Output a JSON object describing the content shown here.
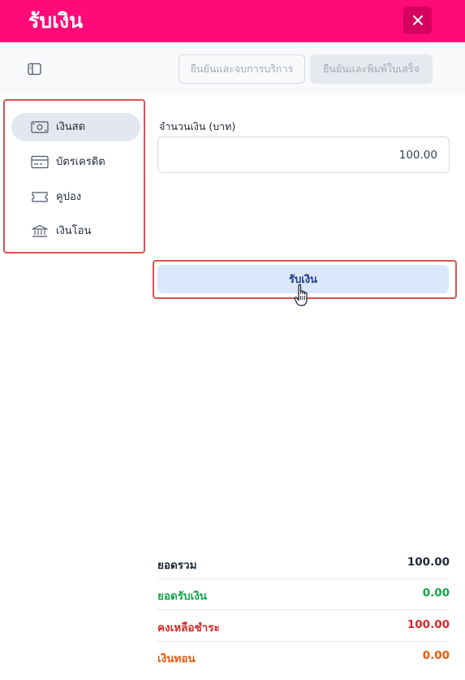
{
  "header": {
    "title": "รับเงิน",
    "close_icon": "close-icon",
    "colors": {
      "header_bg": "#ff0a78",
      "close_bg": "#d6005f"
    }
  },
  "toolbar": {
    "sidebar_toggle_icon": "sidebar-toggle-icon",
    "confirm_end_service_label": "ยืนยันและจบการบริการ",
    "confirm_print_receipt_label": "ยืนยันและพิมพ์ใบเสร็จ"
  },
  "payment_methods": {
    "items": [
      {
        "label": "เงินสด",
        "icon": "cash-icon",
        "active": true
      },
      {
        "label": "บัตรเครดิต",
        "icon": "credit-card-icon",
        "active": false
      },
      {
        "label": "คูปอง",
        "icon": "coupon-icon",
        "active": false
      },
      {
        "label": "เงินโอน",
        "icon": "bank-icon",
        "active": false
      }
    ]
  },
  "form": {
    "amount_label": "จำนวนเงิน (บาท)",
    "amount_value": "100.00",
    "receive_button_label": "รับเงิน"
  },
  "summary": {
    "rows": [
      {
        "label": "ยอดรวม",
        "value": "100.00",
        "color": "#1f2937"
      },
      {
        "label": "ยอดรับเงิน",
        "value": "0.00",
        "color": "#16a34a"
      },
      {
        "label": "คงเหลือชำระ",
        "value": "100.00",
        "color": "#dc2626"
      },
      {
        "label": "เงินทอน",
        "value": "0.00",
        "color": "#ea580c"
      }
    ]
  }
}
